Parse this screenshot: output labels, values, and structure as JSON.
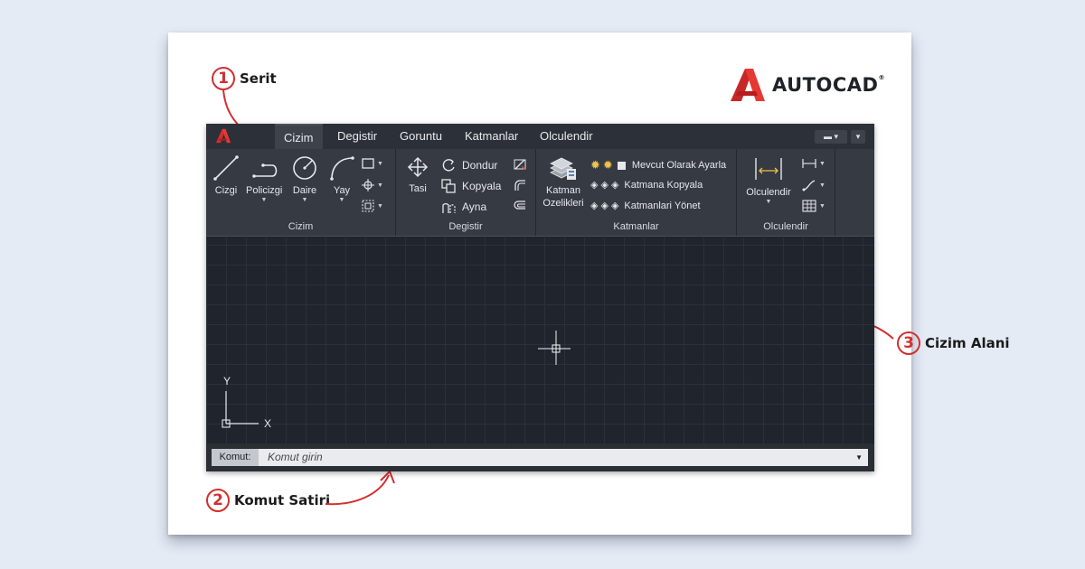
{
  "brand": {
    "name": "AUTOCAD",
    "mark": "®",
    "accent": "#d32f2f"
  },
  "callouts": [
    {
      "number": "1",
      "label": "Serit"
    },
    {
      "number": "2",
      "label": "Komut Satiri"
    },
    {
      "number": "3",
      "label": "Cizim Alani"
    }
  ],
  "app": {
    "logo_letter": "A",
    "tabs": [
      "Cizim",
      "Degistir",
      "Goruntu",
      "Katmanlar",
      "Olculendir"
    ],
    "active_tab": "Cizim",
    "panels": {
      "cizim": {
        "title": "Cizim",
        "tools": [
          "Cizgi",
          "Policizgi",
          "Daire",
          "Yay"
        ],
        "small_tools": [
          "rectangle-icon",
          "point-icon",
          "hatch-icon"
        ]
      },
      "degistir": {
        "title": "Degistir",
        "big_tool": "Tasi",
        "rows": [
          "Dondur",
          "Kopyala",
          "Ayna"
        ],
        "small_tools": [
          "trim-icon",
          "fillet-icon",
          "offset-icon"
        ]
      },
      "katmanlar": {
        "title": "Katmanlar",
        "big_tool_line1": "Katman",
        "big_tool_line2": "Ozelikleri",
        "rows": [
          "Mevcut Olarak Ayarla",
          "Katmana Kopyala",
          "Katmanlari Yönet"
        ]
      },
      "olculendir": {
        "title": "Olculendir",
        "big_tool": "Olculendir",
        "small_tools": [
          "linear-dim-icon",
          "leader-icon",
          "table-icon"
        ]
      }
    },
    "ucs": {
      "x_label": "X",
      "y_label": "Y"
    },
    "command_line": {
      "label": "Komut:",
      "placeholder": "Komut girin"
    }
  }
}
